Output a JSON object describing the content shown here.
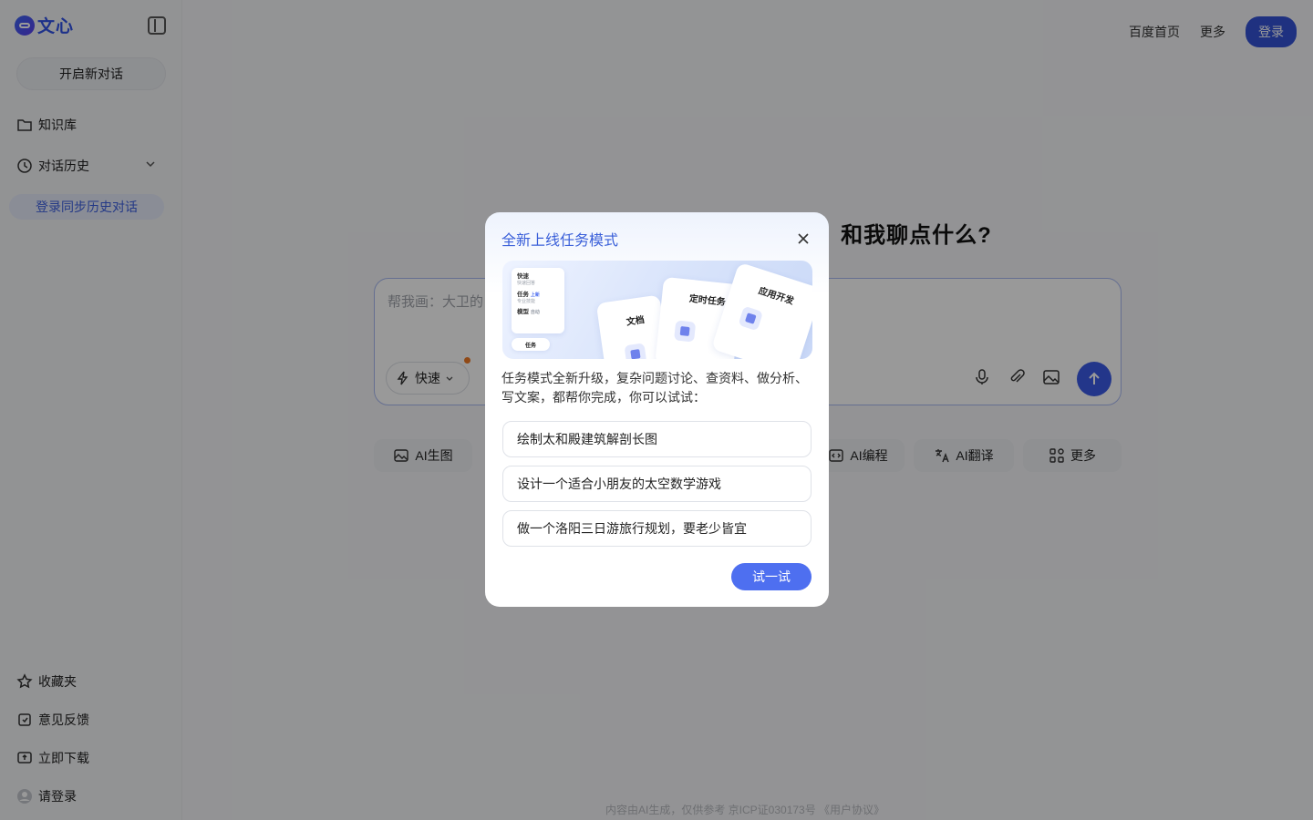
{
  "brand": {
    "name": "文心"
  },
  "sidebar": {
    "new_chat": "开启新对话",
    "knowledge": "知识库",
    "history": "对话历史",
    "sync": "登录同步历史对话",
    "favorites": "收藏夹",
    "feedback": "意见反馈",
    "download": "立即下载",
    "login": "请登录"
  },
  "header": {
    "links": [
      "百度首页",
      "更多"
    ],
    "login": "登录"
  },
  "main": {
    "greeting": "和我聊点什么?",
    "input_placeholder": "帮我画：大卫的",
    "mode_label": "快速",
    "chips": [
      "AI生图",
      "AI编程",
      "AI翻译",
      "更多"
    ]
  },
  "footer": "内容由AI生成，仅供参考  京ICP证030173号  《用户协议》",
  "modal": {
    "title": "全新上线任务模式",
    "banner": {
      "menu": [
        {
          "title": "快速",
          "sub": "快速回答"
        },
        {
          "title": "任务",
          "sub": "专业技能",
          "tag": "上新"
        },
        {
          "title": "模型",
          "sub": "自动"
        }
      ],
      "tab": "任务",
      "cards": [
        "文档",
        "定时任务",
        "应用开发"
      ]
    },
    "description": "任务模式全新升级，复杂问题讨论、查资料、做分析、写文案，都帮你完成，你可以试试：",
    "prompts": [
      "绘制太和殿建筑解剖长图",
      "设计一个适合小朋友的太空数学游戏",
      "做一个洛阳三日游旅行规划，要老少皆宜"
    ],
    "try_button": "试一试"
  },
  "colors": {
    "accent": "#3453d6",
    "modal_title": "#3a5fd9",
    "overlay": "rgba(0,0,0,0.4)"
  }
}
